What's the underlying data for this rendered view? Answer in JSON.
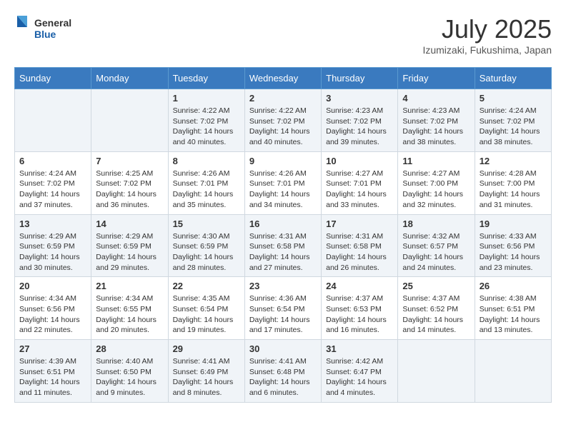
{
  "header": {
    "logo_general": "General",
    "logo_blue": "Blue",
    "month_year": "July 2025",
    "location": "Izumizaki, Fukushima, Japan"
  },
  "weekdays": [
    "Sunday",
    "Monday",
    "Tuesday",
    "Wednesday",
    "Thursday",
    "Friday",
    "Saturday"
  ],
  "weeks": [
    [
      {
        "day": "",
        "sunrise": "",
        "sunset": "",
        "daylight": ""
      },
      {
        "day": "",
        "sunrise": "",
        "sunset": "",
        "daylight": ""
      },
      {
        "day": "1",
        "sunrise": "Sunrise: 4:22 AM",
        "sunset": "Sunset: 7:02 PM",
        "daylight": "Daylight: 14 hours and 40 minutes."
      },
      {
        "day": "2",
        "sunrise": "Sunrise: 4:22 AM",
        "sunset": "Sunset: 7:02 PM",
        "daylight": "Daylight: 14 hours and 40 minutes."
      },
      {
        "day": "3",
        "sunrise": "Sunrise: 4:23 AM",
        "sunset": "Sunset: 7:02 PM",
        "daylight": "Daylight: 14 hours and 39 minutes."
      },
      {
        "day": "4",
        "sunrise": "Sunrise: 4:23 AM",
        "sunset": "Sunset: 7:02 PM",
        "daylight": "Daylight: 14 hours and 38 minutes."
      },
      {
        "day": "5",
        "sunrise": "Sunrise: 4:24 AM",
        "sunset": "Sunset: 7:02 PM",
        "daylight": "Daylight: 14 hours and 38 minutes."
      }
    ],
    [
      {
        "day": "6",
        "sunrise": "Sunrise: 4:24 AM",
        "sunset": "Sunset: 7:02 PM",
        "daylight": "Daylight: 14 hours and 37 minutes."
      },
      {
        "day": "7",
        "sunrise": "Sunrise: 4:25 AM",
        "sunset": "Sunset: 7:02 PM",
        "daylight": "Daylight: 14 hours and 36 minutes."
      },
      {
        "day": "8",
        "sunrise": "Sunrise: 4:26 AM",
        "sunset": "Sunset: 7:01 PM",
        "daylight": "Daylight: 14 hours and 35 minutes."
      },
      {
        "day": "9",
        "sunrise": "Sunrise: 4:26 AM",
        "sunset": "Sunset: 7:01 PM",
        "daylight": "Daylight: 14 hours and 34 minutes."
      },
      {
        "day": "10",
        "sunrise": "Sunrise: 4:27 AM",
        "sunset": "Sunset: 7:01 PM",
        "daylight": "Daylight: 14 hours and 33 minutes."
      },
      {
        "day": "11",
        "sunrise": "Sunrise: 4:27 AM",
        "sunset": "Sunset: 7:00 PM",
        "daylight": "Daylight: 14 hours and 32 minutes."
      },
      {
        "day": "12",
        "sunrise": "Sunrise: 4:28 AM",
        "sunset": "Sunset: 7:00 PM",
        "daylight": "Daylight: 14 hours and 31 minutes."
      }
    ],
    [
      {
        "day": "13",
        "sunrise": "Sunrise: 4:29 AM",
        "sunset": "Sunset: 6:59 PM",
        "daylight": "Daylight: 14 hours and 30 minutes."
      },
      {
        "day": "14",
        "sunrise": "Sunrise: 4:29 AM",
        "sunset": "Sunset: 6:59 PM",
        "daylight": "Daylight: 14 hours and 29 minutes."
      },
      {
        "day": "15",
        "sunrise": "Sunrise: 4:30 AM",
        "sunset": "Sunset: 6:59 PM",
        "daylight": "Daylight: 14 hours and 28 minutes."
      },
      {
        "day": "16",
        "sunrise": "Sunrise: 4:31 AM",
        "sunset": "Sunset: 6:58 PM",
        "daylight": "Daylight: 14 hours and 27 minutes."
      },
      {
        "day": "17",
        "sunrise": "Sunrise: 4:31 AM",
        "sunset": "Sunset: 6:58 PM",
        "daylight": "Daylight: 14 hours and 26 minutes."
      },
      {
        "day": "18",
        "sunrise": "Sunrise: 4:32 AM",
        "sunset": "Sunset: 6:57 PM",
        "daylight": "Daylight: 14 hours and 24 minutes."
      },
      {
        "day": "19",
        "sunrise": "Sunrise: 4:33 AM",
        "sunset": "Sunset: 6:56 PM",
        "daylight": "Daylight: 14 hours and 23 minutes."
      }
    ],
    [
      {
        "day": "20",
        "sunrise": "Sunrise: 4:34 AM",
        "sunset": "Sunset: 6:56 PM",
        "daylight": "Daylight: 14 hours and 22 minutes."
      },
      {
        "day": "21",
        "sunrise": "Sunrise: 4:34 AM",
        "sunset": "Sunset: 6:55 PM",
        "daylight": "Daylight: 14 hours and 20 minutes."
      },
      {
        "day": "22",
        "sunrise": "Sunrise: 4:35 AM",
        "sunset": "Sunset: 6:54 PM",
        "daylight": "Daylight: 14 hours and 19 minutes."
      },
      {
        "day": "23",
        "sunrise": "Sunrise: 4:36 AM",
        "sunset": "Sunset: 6:54 PM",
        "daylight": "Daylight: 14 hours and 17 minutes."
      },
      {
        "day": "24",
        "sunrise": "Sunrise: 4:37 AM",
        "sunset": "Sunset: 6:53 PM",
        "daylight": "Daylight: 14 hours and 16 minutes."
      },
      {
        "day": "25",
        "sunrise": "Sunrise: 4:37 AM",
        "sunset": "Sunset: 6:52 PM",
        "daylight": "Daylight: 14 hours and 14 minutes."
      },
      {
        "day": "26",
        "sunrise": "Sunrise: 4:38 AM",
        "sunset": "Sunset: 6:51 PM",
        "daylight": "Daylight: 14 hours and 13 minutes."
      }
    ],
    [
      {
        "day": "27",
        "sunrise": "Sunrise: 4:39 AM",
        "sunset": "Sunset: 6:51 PM",
        "daylight": "Daylight: 14 hours and 11 minutes."
      },
      {
        "day": "28",
        "sunrise": "Sunrise: 4:40 AM",
        "sunset": "Sunset: 6:50 PM",
        "daylight": "Daylight: 14 hours and 9 minutes."
      },
      {
        "day": "29",
        "sunrise": "Sunrise: 4:41 AM",
        "sunset": "Sunset: 6:49 PM",
        "daylight": "Daylight: 14 hours and 8 minutes."
      },
      {
        "day": "30",
        "sunrise": "Sunrise: 4:41 AM",
        "sunset": "Sunset: 6:48 PM",
        "daylight": "Daylight: 14 hours and 6 minutes."
      },
      {
        "day": "31",
        "sunrise": "Sunrise: 4:42 AM",
        "sunset": "Sunset: 6:47 PM",
        "daylight": "Daylight: 14 hours and 4 minutes."
      },
      {
        "day": "",
        "sunrise": "",
        "sunset": "",
        "daylight": ""
      },
      {
        "day": "",
        "sunrise": "",
        "sunset": "",
        "daylight": ""
      }
    ]
  ]
}
